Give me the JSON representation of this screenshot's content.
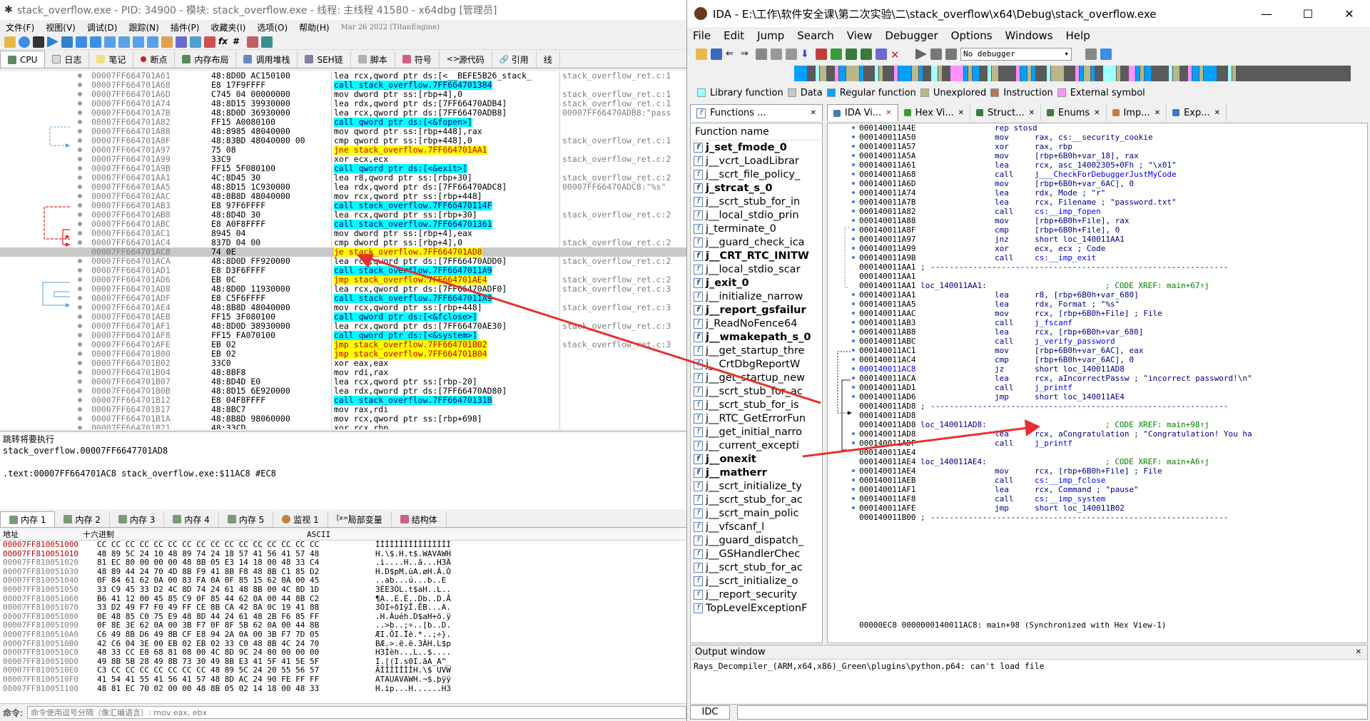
{
  "x64dbg": {
    "title": "stack_overflow.exe - PID: 34900 - 模块: stack_overflow.exe - 线程: 主线程 41580 - x64dbg [管理员]",
    "menu": [
      "文件(F)",
      "视图(V)",
      "调试(D)",
      "跟踪(N)",
      "插件(P)",
      "收藏夹(I)",
      "选项(O)",
      "帮助(H)",
      "Mar 26 2022 (TitanEngine)"
    ],
    "tabs": [
      "CPU",
      "日志",
      "笔记",
      "断点",
      "内存布局",
      "调用堆栈",
      "SEH链",
      "脚本",
      "符号",
      "源代码",
      "引用",
      "线"
    ],
    "disasm": [
      {
        "addr": "00007FF664701A61",
        "bytes": "48:8D0D AC150100",
        "ins": "lea rcx,qword ptr ds:[<__BEFE5B26_stack_",
        "cmt": "stack_overflow_ret.c:1",
        "k": "hy"
      },
      {
        "addr": "00007FF664701A68",
        "bytes": "E8 17F9FFFF",
        "ins": "call stack_overflow.7FF664701384",
        "cmt": "",
        "k": "call"
      },
      {
        "addr": "00007FF664701A6D",
        "bytes": "C745 04 00000000",
        "ins": "mov dword ptr ss:[rbp+4],0",
        "cmt": "stack_overflow_ret.c:1",
        "k": ""
      },
      {
        "addr": "00007FF664701A74",
        "bytes": "48:8D15 39930000",
        "ins": "lea rdx,qword ptr ds:[7FF66470ADB4]",
        "cmt": "stack_overflow_ret.c:1",
        "k": "hy"
      },
      {
        "addr": "00007FF664701A7B",
        "bytes": "48:8D0D 36930000",
        "ins": "lea rcx,qword ptr ds:[7FF66470ADB8]",
        "cmt": "00007FF66470ADB8:\"pass",
        "k": "hy"
      },
      {
        "addr": "00007FF664701A82",
        "bytes": "FF15 A0080100",
        "ins": "call qword ptr ds:[<&fopen>]",
        "cmt": "",
        "k": "call"
      },
      {
        "addr": "00007FF664701A88",
        "bytes": "48:8985 48040000",
        "ins": "mov qword ptr ss:[rbp+448],rax",
        "cmt": "",
        "k": ""
      },
      {
        "addr": "00007FF664701A8F",
        "bytes": "48:83BD 48040000 00",
        "ins": "cmp qword ptr ss:[rbp+448],0",
        "cmt": "stack_overflow_ret.c:1",
        "k": ""
      },
      {
        "addr": "00007FF664701A97",
        "bytes": "75 08",
        "ins": "jne stack_overflow.7FF664701AA1",
        "cmt": "",
        "k": "j"
      },
      {
        "addr": "00007FF664701A99",
        "bytes": "33C9",
        "ins": "xor ecx,ecx",
        "cmt": "stack_overflow_ret.c:2",
        "k": ""
      },
      {
        "addr": "00007FF664701A9B",
        "bytes": "FF15 5F080100",
        "ins": "call qword ptr ds:[<&exit>]",
        "cmt": "",
        "k": "call"
      },
      {
        "addr": "00007FF664701AA1",
        "bytes": "4C:8D45 30",
        "ins": "lea r8,qword ptr ss:[rbp+30]",
        "cmt": "stack_overflow_ret.c:2",
        "k": ""
      },
      {
        "addr": "00007FF664701AA5",
        "bytes": "48:8D15 1C930000",
        "ins": "lea rdx,qword ptr ds:[7FF66470ADC8]",
        "cmt": "00007FF66470ADC8:\"%s\"",
        "k": "hy"
      },
      {
        "addr": "00007FF664701AAC",
        "bytes": "48:8B8D 48040000",
        "ins": "mov rcx,qword ptr ss:[rbp+448]",
        "cmt": "",
        "k": ""
      },
      {
        "addr": "00007FF664701AB3",
        "bytes": "E8 97F6FFFF",
        "ins": "call stack_overflow.7FF66470114F",
        "cmt": "",
        "k": "call"
      },
      {
        "addr": "00007FF664701AB8",
        "bytes": "48:8D4D 30",
        "ins": "lea rcx,qword ptr ss:[rbp+30]",
        "cmt": "stack_overflow_ret.c:2",
        "k": ""
      },
      {
        "addr": "00007FF664701ABC",
        "bytes": "E8 A0F8FFFF",
        "ins": "call stack_overflow.7FF664701361",
        "cmt": "",
        "k": "call"
      },
      {
        "addr": "00007FF664701AC1",
        "bytes": "8945 04",
        "ins": "mov dword ptr ss:[rbp+4],eax",
        "cmt": "",
        "k": ""
      },
      {
        "addr": "00007FF664701AC4",
        "bytes": "837D 04 00",
        "ins": "cmp dword ptr ss:[rbp+4],0",
        "cmt": "stack_overflow_ret.c:2",
        "k": ""
      },
      {
        "addr": "00007FF664701AC8",
        "bytes": "74 0E",
        "ins": "je stack_overflow.7FF664701AD8",
        "cmt": "",
        "k": "j",
        "sel": true
      },
      {
        "addr": "00007FF664701ACA",
        "bytes": "48:8D0D FF920000",
        "ins": "lea rcx,qword ptr ds:[7FF66470ADD0]",
        "cmt": "stack_overflow_ret.c:2",
        "k": "hy"
      },
      {
        "addr": "00007FF664701AD1",
        "bytes": "E8 D3F6FFFF",
        "ins": "call stack_overflow.7FF6647011A9",
        "cmt": "",
        "k": "call"
      },
      {
        "addr": "00007FF664701AD6",
        "bytes": "EB 0C",
        "ins": "jmp stack_overflow.7FF664701AE4",
        "cmt": "stack_overflow_ret.c:2",
        "k": "j"
      },
      {
        "addr": "00007FF664701AD8",
        "bytes": "48:8D0D 11930000",
        "ins": "lea rcx,qword ptr ds:[7FF66470ADF0]",
        "cmt": "stack_overflow_ret.c:3",
        "k": "hy"
      },
      {
        "addr": "00007FF664701ADF",
        "bytes": "E8 C5F6FFFF",
        "ins": "call stack_overflow.7FF6647011A9",
        "cmt": "",
        "k": "call"
      },
      {
        "addr": "00007FF664701AE4",
        "bytes": "48:8B8D 48040000",
        "ins": "mov rcx,qword ptr ss:[rbp+448]",
        "cmt": "stack_overflow_ret.c:3",
        "k": ""
      },
      {
        "addr": "00007FF664701AEB",
        "bytes": "FF15 3F080100",
        "ins": "call qword ptr ds:[<&fclose>]",
        "cmt": "",
        "k": "call"
      },
      {
        "addr": "00007FF664701AF1",
        "bytes": "48:8D0D 38930000",
        "ins": "lea rcx,qword ptr ds:[7FF66470AE30]",
        "cmt": "stack_overflow_ret.c:3",
        "k": "hy"
      },
      {
        "addr": "00007FF664701AF8",
        "bytes": "FF15 FA070100",
        "ins": "call qword ptr ds:[<&system>]",
        "cmt": "",
        "k": "call"
      },
      {
        "addr": "00007FF664701AFE",
        "bytes": "EB 02",
        "ins": "jmp stack_overflow.7FF664701B02",
        "cmt": "stack_overflow_ret.c:3",
        "k": "j"
      },
      {
        "addr": "00007FF664701B00",
        "bytes": "EB 02",
        "ins": "jmp stack_overflow.7FF664701B04",
        "cmt": "",
        "k": "j"
      },
      {
        "addr": "00007FF664701B02",
        "bytes": "33C0",
        "ins": "xor eax,eax",
        "cmt": "",
        "k": ""
      },
      {
        "addr": "00007FF664701B04",
        "bytes": "48:8BF8",
        "ins": "mov rdi,rax",
        "cmt": "",
        "k": ""
      },
      {
        "addr": "00007FF664701B07",
        "bytes": "48:8D4D E0",
        "ins": "lea rcx,qword ptr ss:[rbp-20]",
        "cmt": "",
        "k": ""
      },
      {
        "addr": "00007FF664701B0B",
        "bytes": "48:8D15 6E920000",
        "ins": "lea rdx,qword ptr ds:[7FF66470AD80]",
        "cmt": "",
        "k": "hy"
      },
      {
        "addr": "00007FF664701B12",
        "bytes": "E8 04F8FFFF",
        "ins": "call stack_overflow.7FF66470131B",
        "cmt": "",
        "k": "call"
      },
      {
        "addr": "00007FF664701B17",
        "bytes": "48:8BC7",
        "ins": "mov rax,rdi",
        "cmt": "",
        "k": ""
      },
      {
        "addr": "00007FF664701B1A",
        "bytes": "48:8B8D 98060000",
        "ins": "mov rcx,qword ptr ss:[rbp+698]",
        "cmt": "",
        "k": ""
      },
      {
        "addr": "00007FF664701B21",
        "bytes": "48:33CD",
        "ins": "xor rcx,rbp",
        "cmt": "",
        "k": ""
      }
    ],
    "info": [
      "跳转将要执行",
      "stack_overflow.00007FF6647701AD8",
      "",
      ".text:00007FF664701AC8 stack_overflow.exe:$11AC8 #EC8"
    ],
    "mem_tabs": [
      "内存 1",
      "内存 2",
      "内存 3",
      "内存 4",
      "内存 5",
      "监视 1",
      "局部变量",
      "结构体"
    ],
    "dump_header": {
      "addr": "地址",
      "hex": "十六进制",
      "ascii": "ASCII"
    },
    "dump": [
      {
        "a": "00007FF810051000",
        "h": "CC CC CC CC CC CC CC CC CC CC CC CC CC CC CC CC",
        "s": "ÌÌÌÌÌÌÌÌÌÌÌÌÌÌÌÌ"
      },
      {
        "a": "00007FF810051010",
        "h": "48 89 5C 24 10 48 89 74 24 18 57 41 56 41 57 48",
        "s": "H.\\$.H.t$.WAVAWH"
      },
      {
        "a": "00007FF810051020",
        "h": "81 EC 80 00 00 00 48 8B 05 E3 14 18 00 48 33 C4",
        "s": ".ì....H..ã...H3Ä"
      },
      {
        "a": "00007FF810051030",
        "h": "48 89 44 24 70 4D 8B F9 41 8B F8 48 8B C1 85 D2",
        "s": "H.D$pM.ùA.øH.Á.Ò"
      },
      {
        "a": "00007FF810051040",
        "h": "0F 84 61 62 0A 00 83 FA 0A 0F 85 15 62 0A 00 45",
        "s": "..ab...ú...b..E"
      },
      {
        "a": "00007FF810051050",
        "h": "33 C9 45 33 D2 4C 8D 74 24 61 48 8B 00 4C 8D 1D",
        "s": "3ÉE3ÒL.t$aH..L.."
      },
      {
        "a": "00007FF810051060",
        "h": "B6 41 12 00 45 85 C9 0F 85 44 62 0A 00 44 8B C2",
        "s": "¶A..E.É..Db..D.Â"
      },
      {
        "a": "00007FF810051070",
        "h": "33 D2 49 F7 F0 49 FF CE 8B CA 42 8A 0C 19 41 88",
        "s": "3ÒI÷ðIÿÎ.ÊB...A."
      },
      {
        "a": "00007FF810051080",
        "h": "0E 48 85 C0 75 E9 48 8D 44 24 61 48 2B F6 85 FF",
        "s": ".H.Àuéh.D$aH+ö.ÿ"
      },
      {
        "a": "00007FF810051090",
        "h": "0F 8E 3E 62 0A 00 3B F7 0F 8F 5B 62 0A 00 44 8B",
        "s": "..>b..;÷..[b..D."
      },
      {
        "a": "00007FF8100510A0",
        "h": "C6 49 8B D6 49 8B CF E8 94 2A 0A 00 3B F7 7D 05",
        "s": "ÆI.ÖI.Ïè.*..;÷}."
      },
      {
        "a": "00007FF8100510B0",
        "h": "42 C6 04 3E 00 EB 02 EB 02 33 C0 48 8B 4C 24 70",
        "s": "BÆ.>.ë.ë.3ÀH.L$p"
      },
      {
        "a": "00007FF8100510C0",
        "h": "48 33 CC E8 68 81 08 00 4C 8D 9C 24 80 00 00 00",
        "s": "H3Ìèh...L..$...."
      },
      {
        "a": "00007FF8100510D0",
        "h": "49 8B 5B 28 49 8B 73 30 49 8B E3 41 5F 41 5E 5F",
        "s": "I.[(I.s0I.ãA_A^_"
      },
      {
        "a": "00007FF8100510E0",
        "h": "C3 CC CC CC CC CC CC CC 48 89 5C 24 20 55 56 57",
        "s": "ÃÌÌÌÌÌÌÌH.\\$ UVW"
      },
      {
        "a": "00007FF8100510F0",
        "h": "41 54 41 55 41 56 41 57 48 8D AC 24 90 FE FF FF",
        "s": "ATAUAVAWH.¬$.þÿÿ"
      },
      {
        "a": "00007FF810051100",
        "h": "48 81 EC 70 02 00 00 48 8B 05 02 14 18 00 48 33",
        "s": "H.ìp...H......H3"
      }
    ],
    "cmd_label": "命令:",
    "cmd_placeholder": "命令使用逗号分隔（像汇编语言）: mov eax, ebx"
  },
  "ida": {
    "title": "IDA - E:\\工作\\软件安全课\\第二次实验\\二\\stack_overflow\\x64\\Debug\\stack_overflow.exe",
    "menu": [
      "File",
      "Edit",
      "Jump",
      "Search",
      "View",
      "Debugger",
      "Options",
      "Windows",
      "Help"
    ],
    "debugger_select": "No debugger",
    "legend": [
      "Library function",
      "Data",
      "Regular function",
      "Unexplored",
      "Instruction",
      "External symbol"
    ],
    "legend_colors": [
      "#a0ffff",
      "#c8c8c8",
      "#00a0ff",
      "#b8b888",
      "#b07858",
      "#ff90ff"
    ],
    "left_tab": "Functions ...",
    "tabs": [
      "IDA Vi...",
      "Hex Vi...",
      "Struct...",
      "Enums",
      "Imp...",
      "Exp..."
    ],
    "func_header": "Function name",
    "functions": [
      {
        "n": "j_set_fmode_0",
        "b": true
      },
      {
        "n": "j__vcrt_LoadLibrar",
        "b": false
      },
      {
        "n": "j__scrt_file_policy_",
        "b": false
      },
      {
        "n": "j_strcat_s_0",
        "b": true
      },
      {
        "n": "j__scrt_stub_for_in",
        "b": false
      },
      {
        "n": "j__local_stdio_prin",
        "b": false
      },
      {
        "n": "j_terminate_0",
        "b": false
      },
      {
        "n": "j__guard_check_ica",
        "b": false
      },
      {
        "n": "j__CRT_RTC_INITW",
        "b": true
      },
      {
        "n": "j__local_stdio_scar",
        "b": false
      },
      {
        "n": "j_exit_0",
        "b": true
      },
      {
        "n": "j__initialize_narrow",
        "b": false
      },
      {
        "n": "j__report_gsfailur",
        "b": true
      },
      {
        "n": "j_ReadNoFence64",
        "b": false
      },
      {
        "n": "j__wmakepath_s_0",
        "b": true
      },
      {
        "n": "j__get_startup_thre",
        "b": false
      },
      {
        "n": "j__CrtDbgReportW",
        "b": false
      },
      {
        "n": "j__get_startup_new",
        "b": false
      },
      {
        "n": "j__scrt_stub_for_ac",
        "b": false
      },
      {
        "n": "j__scrt_stub_for_is",
        "b": false
      },
      {
        "n": "j__RTC_GetErrorFun",
        "b": false
      },
      {
        "n": "j__get_initial_narro",
        "b": false
      },
      {
        "n": "j__current_excepti",
        "b": false
      },
      {
        "n": "j__onexit",
        "b": true
      },
      {
        "n": "j__matherr",
        "b": true
      },
      {
        "n": "j__scrt_initialize_ty",
        "b": false
      },
      {
        "n": "j__scrt_stub_for_ac",
        "b": false
      },
      {
        "n": "j__scrt_main_polic",
        "b": false
      },
      {
        "n": "j__vfscanf_l",
        "b": false
      },
      {
        "n": "j__guard_dispatch_",
        "b": false
      },
      {
        "n": "j__GSHandlerChec",
        "b": false
      },
      {
        "n": "j__scrt_stub_for_ac",
        "b": false
      },
      {
        "n": "j__scrt_initialize_o",
        "b": false
      },
      {
        "n": "j__report_security",
        "b": false
      },
      {
        "n": "TopLevelExceptionF",
        "b": false
      }
    ],
    "listing": [
      {
        "a": "000140011A4E",
        "l": "",
        "m": "rep stosd",
        "o": "",
        "c": ""
      },
      {
        "a": "000140011A50",
        "l": "",
        "m": "mov",
        "o": "rax, cs:__security_cookie",
        "c": ""
      },
      {
        "a": "000140011A57",
        "l": "",
        "m": "xor",
        "o": "rax, rbp",
        "c": ""
      },
      {
        "a": "000140011A5A",
        "l": "",
        "m": "mov",
        "o": "[rbp+6B0h+var_18], rax",
        "c": ""
      },
      {
        "a": "000140011A61",
        "l": "",
        "m": "lea",
        "o": "rcx, asc_14002305+0Fh ; \"\\x01\"",
        "c": ""
      },
      {
        "a": "000140011A68",
        "l": "",
        "m": "call",
        "o": "j___CheckForDebuggerJustMyCode",
        "c": ""
      },
      {
        "a": "000140011A6D",
        "l": "",
        "m": "mov",
        "o": "[rbp+6B0h+var_6AC], 0",
        "c": ""
      },
      {
        "a": "000140011A74",
        "l": "",
        "m": "lea",
        "o": "rdx, Mode       ; \"r\"",
        "c": ""
      },
      {
        "a": "000140011A7B",
        "l": "",
        "m": "lea",
        "o": "rcx, Filename   ; \"password.txt\"",
        "c": ""
      },
      {
        "a": "000140011A82",
        "l": "",
        "m": "call",
        "o": "cs:__imp_fopen",
        "c": ""
      },
      {
        "a": "000140011A88",
        "l": "",
        "m": "mov",
        "o": "[rbp+6B0h+File], rax",
        "c": ""
      },
      {
        "a": "000140011A8F",
        "l": "",
        "m": "cmp",
        "o": "[rbp+6B0h+File], 0",
        "c": ""
      },
      {
        "a": "000140011A97",
        "l": "",
        "m": "jnz",
        "o": "short loc_140011AA1",
        "c": ""
      },
      {
        "a": "000140011A99",
        "l": "",
        "m": "xor",
        "o": "ecx, ecx        ; Code",
        "c": ""
      },
      {
        "a": "000140011A9B",
        "l": "",
        "m": "call",
        "o": "cs:__imp_exit",
        "c": ""
      },
      {
        "a": "000140011AA1",
        "l": ";",
        "m": "",
        "o": "---------------------------------------------------------------",
        "c": "sep"
      },
      {
        "a": "000140011AA1",
        "l": "",
        "m": "",
        "o": "",
        "c": ""
      },
      {
        "a": "000140011AA1",
        "l": "loc_140011AA1:",
        "m": "",
        "o": "",
        "c": "; CODE XREF: main+67↑j"
      },
      {
        "a": "000140011AA1",
        "l": "",
        "m": "lea",
        "o": "r8, [rbp+6B0h+var_680]",
        "c": ""
      },
      {
        "a": "000140011AA5",
        "l": "",
        "m": "lea",
        "o": "rdx, Format     ; \"%s\"",
        "c": ""
      },
      {
        "a": "000140011AAC",
        "l": "",
        "m": "mov",
        "o": "rcx, [rbp+6B0h+File] ; File",
        "c": ""
      },
      {
        "a": "000140011AB3",
        "l": "",
        "m": "call",
        "o": "j_fscanf",
        "c": ""
      },
      {
        "a": "000140011AB8",
        "l": "",
        "m": "lea",
        "o": "rcx, [rbp+6B0h+var_680]",
        "c": ""
      },
      {
        "a": "000140011ABC",
        "l": "",
        "m": "call",
        "o": "j_verify_password",
        "c": ""
      },
      {
        "a": "000140011AC1",
        "l": "",
        "m": "mov",
        "o": "[rbp+6B0h+var_6AC], eax",
        "c": ""
      },
      {
        "a": "000140011AC4",
        "l": "",
        "m": "cmp",
        "o": "[rbp+6B0h+var_6AC], 0",
        "c": ""
      },
      {
        "a": "000140011AC8",
        "l": "",
        "m": "jz",
        "o": "short loc_140011AD8",
        "c": "",
        "sel": true
      },
      {
        "a": "000140011ACA",
        "l": "",
        "m": "lea",
        "o": "rcx, aIncorrectPassw ; \"incorrect password!\\n\"",
        "c": ""
      },
      {
        "a": "000140011AD1",
        "l": "",
        "m": "call",
        "o": "j_printf",
        "c": ""
      },
      {
        "a": "000140011AD6",
        "l": "",
        "m": "jmp",
        "o": "short loc_140011AE4",
        "c": ""
      },
      {
        "a": "000140011AD8",
        "l": ";",
        "m": "",
        "o": "---------------------------------------------------------------",
        "c": "sep"
      },
      {
        "a": "000140011AD8",
        "l": "",
        "m": "",
        "o": "",
        "c": ""
      },
      {
        "a": "000140011AD8",
        "l": "loc_140011AD8:",
        "m": "",
        "o": "",
        "c": "; CODE XREF: main+98↑j"
      },
      {
        "a": "000140011AD8",
        "l": "",
        "m": "lea",
        "o": "rcx, aCongratulation ; \"Congratulation! You ha",
        "c": ""
      },
      {
        "a": "000140011ADF",
        "l": "",
        "m": "call",
        "o": "j_printf",
        "c": ""
      },
      {
        "a": "000140011AE4",
        "l": "",
        "m": "",
        "o": "",
        "c": ""
      },
      {
        "a": "000140011AE4",
        "l": "loc_140011AE4:",
        "m": "",
        "o": "",
        "c": "; CODE XREF: main+A6↑j"
      },
      {
        "a": "000140011AE4",
        "l": "",
        "m": "mov",
        "o": "rcx, [rbp+6B0h+File] ; File",
        "c": ""
      },
      {
        "a": "000140011AEB",
        "l": "",
        "m": "call",
        "o": "cs:__imp_fclose",
        "c": ""
      },
      {
        "a": "000140011AF1",
        "l": "",
        "m": "lea",
        "o": "rcx, Command    ; \"pause\"",
        "c": ""
      },
      {
        "a": "000140011AF8",
        "l": "",
        "m": "call",
        "o": "cs:__imp_system",
        "c": ""
      },
      {
        "a": "000140011AFE",
        "l": "",
        "m": "jmp",
        "o": "short loc_140011B02",
        "c": ""
      },
      {
        "a": "000140011B00",
        "l": ";",
        "m": "",
        "o": "---------------------------------------------------------------",
        "c": "sep"
      }
    ],
    "status": "00000EC8 0000000140011AC8: main+98 (Synchronized with Hex View-1)",
    "output_title": "Output window",
    "output_lines": [
      "Rays_Decompiler_(ARM,x64,x86)_Green\\plugins\\python.p64: can't load file"
    ],
    "idc_label": "IDC"
  }
}
